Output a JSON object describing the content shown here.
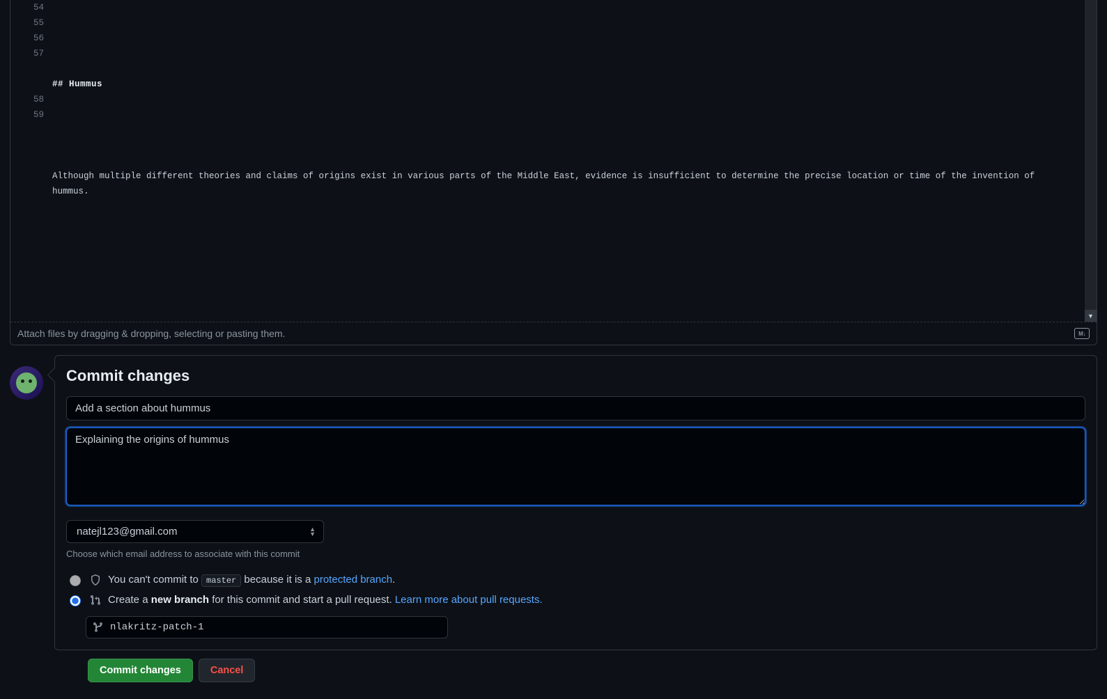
{
  "editor": {
    "lines": {
      "54": "",
      "55": "## Hummus",
      "56": "",
      "57": "Although multiple different theories and claims of origins exist in various parts of the Middle East, evidence is insufficient to determine the precise location or time of the invention of hummus.",
      "58": "",
      "59": ""
    },
    "attach_hint": "Attach files by dragging & dropping, selecting or pasting them.",
    "markdown_badge": "M↓"
  },
  "commit": {
    "heading": "Commit changes",
    "summary_value": "Add a section about hummus",
    "description_value": "Explaining the origins of hummus",
    "email_option": "natejl123@gmail.com",
    "email_help": "Choose which email address to associate with this commit",
    "radio_a": {
      "text_pre": "You can't commit to ",
      "branch": "master",
      "text_mid": " because it is a ",
      "link": "protected branch",
      "text_post": "."
    },
    "radio_b": {
      "text_pre": "Create a ",
      "bold": "new branch",
      "text_mid": " for this commit and start a pull request. ",
      "link": "Learn more about pull requests."
    },
    "new_branch_name": "nlakritz-patch-1"
  },
  "actions": {
    "commit": "Commit changes",
    "cancel": "Cancel"
  }
}
